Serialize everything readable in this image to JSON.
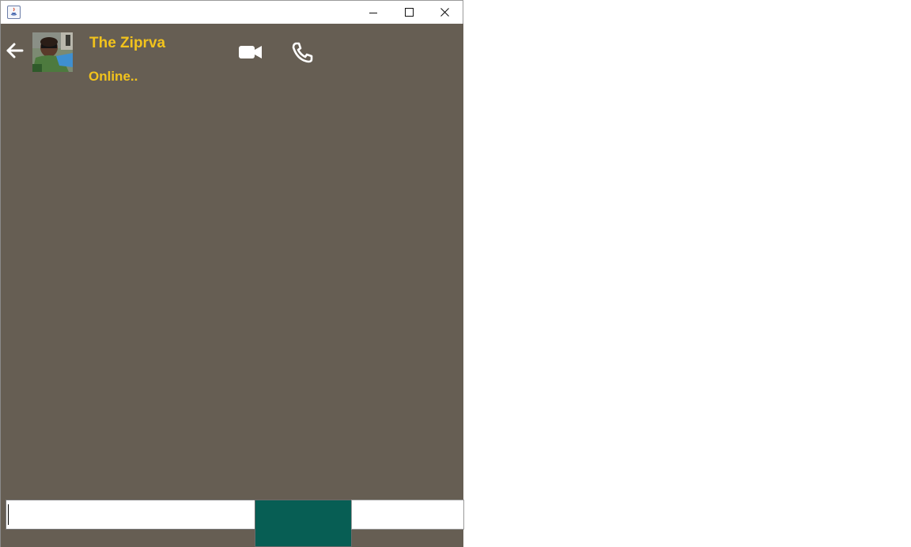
{
  "window": {
    "title": "",
    "app_icon": "java-icon",
    "controls": [
      "minimize-icon",
      "maximize-icon",
      "close-icon"
    ]
  },
  "header": {
    "back_icon": "arrow-left-icon",
    "avatar": "contact-avatar",
    "contact_name": "The Ziprva",
    "status": "Online..",
    "video_icon": "video-camera-icon",
    "phone_icon": "phone-icon"
  },
  "composer": {
    "message_value": "",
    "send_label": ""
  },
  "colors": {
    "chat_background": "#665e53",
    "accent_text": "#f2c31c",
    "send_button": "#075e54"
  }
}
